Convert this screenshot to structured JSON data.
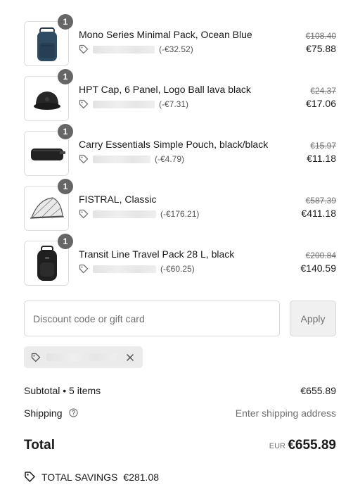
{
  "items": [
    {
      "name": "Mono Series Minimal Pack, Ocean Blue",
      "quantity": "1",
      "discount": "(-€32.52)",
      "original_price": "€108.40",
      "price": "€75.88",
      "thumb_icon": "backpack-blue-icon"
    },
    {
      "name": "HPT Cap, 6 Panel, Logo Ball lava black",
      "quantity": "1",
      "discount": "(-€7.31)",
      "original_price": "€24.37",
      "price": "€17.06",
      "thumb_icon": "cap-icon"
    },
    {
      "name": "Carry Essentials Simple Pouch, black/black",
      "quantity": "1",
      "discount": "(-€4.79)",
      "original_price": "€15.97",
      "price": "€11.18",
      "thumb_icon": "pouch-icon"
    },
    {
      "name": "FISTRAL, Classic",
      "quantity": "1",
      "discount": "(-€176.21)",
      "original_price": "€587.39",
      "price": "€411.18",
      "thumb_icon": "tent-icon"
    },
    {
      "name": "Transit Line Travel Pack 28 L, black",
      "quantity": "1",
      "discount": "(-€60.25)",
      "original_price": "€200.84",
      "price": "€140.59",
      "thumb_icon": "backpack-black-icon"
    }
  ],
  "discount_field": {
    "placeholder": "Discount code or gift card",
    "value": ""
  },
  "apply_label": "Apply",
  "summary": {
    "subtotal_label": "Subtotal • 5 items",
    "subtotal_value": "€655.89",
    "shipping_label": "Shipping",
    "shipping_value": "Enter shipping address",
    "total_label": "Total",
    "total_currency": "EUR",
    "total_value": "€655.89"
  },
  "savings": {
    "label": "TOTAL SAVINGS",
    "value": "€281.08"
  },
  "colors": {
    "text": "#1a1a1a",
    "muted": "#707070",
    "badge": "#666666",
    "border": "#d9d9d9"
  }
}
